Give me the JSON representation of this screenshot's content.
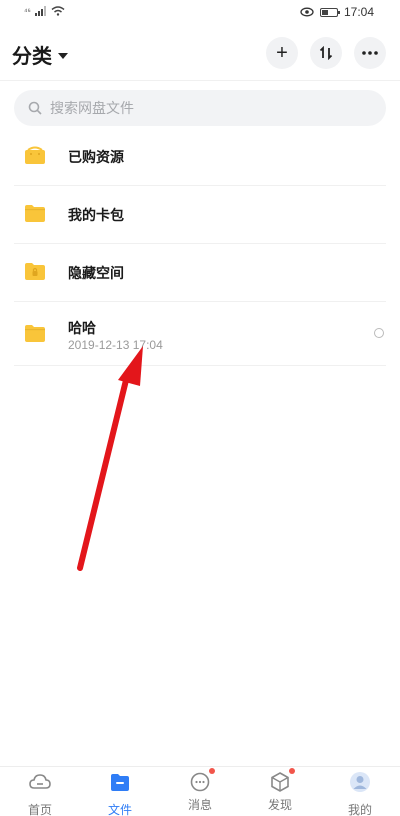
{
  "status": {
    "carrier": "⁴⁶",
    "time": "17:04"
  },
  "header": {
    "title": "分类",
    "add_symbol": "+",
    "sort_symbol": "⇅",
    "more_symbol": "•••"
  },
  "search": {
    "placeholder": "搜索网盘文件"
  },
  "items": [
    {
      "name": "已购资源",
      "icon": "shopping-bag-folder-icon"
    },
    {
      "name": "我的卡包",
      "icon": "folder-icon"
    },
    {
      "name": "隐藏空间",
      "icon": "locked-folder-icon"
    },
    {
      "name": "哈哈",
      "icon": "folder-icon",
      "date": "2019-12-13  17:04"
    }
  ],
  "tabs": [
    {
      "label": "首页",
      "icon": "cloud-icon",
      "active": false
    },
    {
      "label": "文件",
      "icon": "folder-icon",
      "active": true
    },
    {
      "label": "消息",
      "icon": "message-icon",
      "active": false,
      "badge": true
    },
    {
      "label": "发现",
      "icon": "cube-icon",
      "active": false,
      "badge": true
    },
    {
      "label": "我的",
      "icon": "profile-icon",
      "active": false
    }
  ],
  "colors": {
    "accent": "#2f7df6",
    "folder": "#f9c53a",
    "badge": "#f2554a",
    "arrow": "#e3161b"
  }
}
